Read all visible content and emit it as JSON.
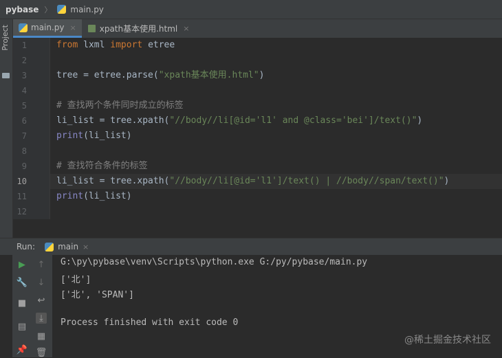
{
  "breadcrumb": {
    "project": "pybase",
    "file": "main.py"
  },
  "left_strip": {
    "label": "Project"
  },
  "tabs": [
    {
      "label": "main.py",
      "icon": "python-file-icon",
      "active": true
    },
    {
      "label": "xpath基本使用.html",
      "icon": "html-file-icon",
      "active": false
    }
  ],
  "tab_close_glyph": "×",
  "editor": {
    "line_numbers": [
      "1",
      "2",
      "3",
      "4",
      "5",
      "6",
      "7",
      "8",
      "9",
      "10",
      "11",
      "12"
    ],
    "current_line": 10,
    "lines": {
      "l1_kw1": "from",
      "l1_mod": " lxml ",
      "l1_kw2": "import",
      "l1_rest": " etree",
      "l3_a": "tree = etree.parse(",
      "l3_str": "\"xpath基本使用.html\"",
      "l3_b": ")",
      "l5_cm": "# 查找两个条件同时成立的标签",
      "l6_a": "li_list = tree.xpath(",
      "l6_str": "\"//body//li[@id='l1' and @class='bei']/text()\"",
      "l6_b": ")",
      "l7_fn": "print",
      "l7_rest": "(li_list)",
      "l9_cm": "# 查找符合条件的标签",
      "l10_a": "li_list = tree.xpath(",
      "l10_str": "\"//body//li[@id='l1']/text() | //body//span/text()\"",
      "l10_b": ")",
      "l11_fn": "print",
      "l11_rest": "(li_list)"
    }
  },
  "run_panel": {
    "label": "Run:",
    "tab": "main",
    "output": [
      "G:\\py\\pybase\\venv\\Scripts\\python.exe G:/py/pybase/main.py",
      "['北']",
      "['北', 'SPAN']",
      "",
      "Process finished with exit code 0"
    ]
  },
  "watermark": "@稀土掘金技术社区",
  "colors": {
    "keyword": "#cc7832",
    "string": "#6a8759",
    "comment": "#808080",
    "builtin": "#8888c6",
    "run_green": "#499c54"
  }
}
